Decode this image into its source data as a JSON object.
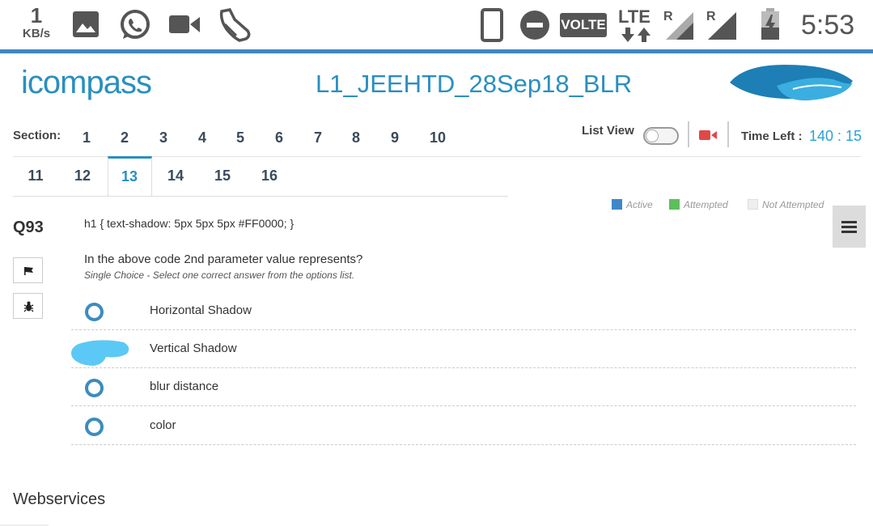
{
  "status_bar": {
    "speed_value": "1",
    "speed_unit": "KB/s",
    "volte": "VOLTE",
    "lte": "LTE",
    "roaming_1": "R",
    "roaming_2": "R",
    "time": "5:53",
    "icons": [
      "gallery-icon",
      "whatsapp-icon",
      "video-camera-icon",
      "shoe-icon",
      "phone-icon",
      "do-not-disturb-icon",
      "lte-arrows-icon",
      "signal-icon",
      "signal-icon",
      "battery-charging-icon"
    ]
  },
  "header": {
    "logo_text": "icompass",
    "title": "L1_JEEHTD_28Sep18_BLR",
    "brand_color": "#2a8fc0"
  },
  "sections": {
    "label": "Section:",
    "items": [
      "1",
      "2",
      "3",
      "4",
      "5",
      "6",
      "7",
      "8",
      "9",
      "10",
      "11",
      "12",
      "13",
      "14",
      "15",
      "16"
    ],
    "active": "13"
  },
  "toolbar": {
    "list_view_label": "List View",
    "list_view_on": false,
    "time_left_label": "Time Left :",
    "time_left_value": "140 : 15"
  },
  "legend": {
    "active_label": "Active",
    "active_color": "#3f87c9",
    "attempted_label": "Attempted",
    "attempted_color": "#5cbf5c",
    "not_attempted_label": "Not Attempted",
    "not_attempted_color": "#eeeeee"
  },
  "question": {
    "number": "Q93",
    "code": "h1 {  text-shadow: 5px 5px 5px #FF0000; }",
    "text": "In the above code 2nd parameter value represents?",
    "hint": "Single Choice - Select one correct answer from the options list.",
    "options": [
      "Horizontal Shadow",
      "Vertical Shadow",
      "blur distance",
      "color"
    ]
  },
  "footer": {
    "text": "Webservices"
  }
}
